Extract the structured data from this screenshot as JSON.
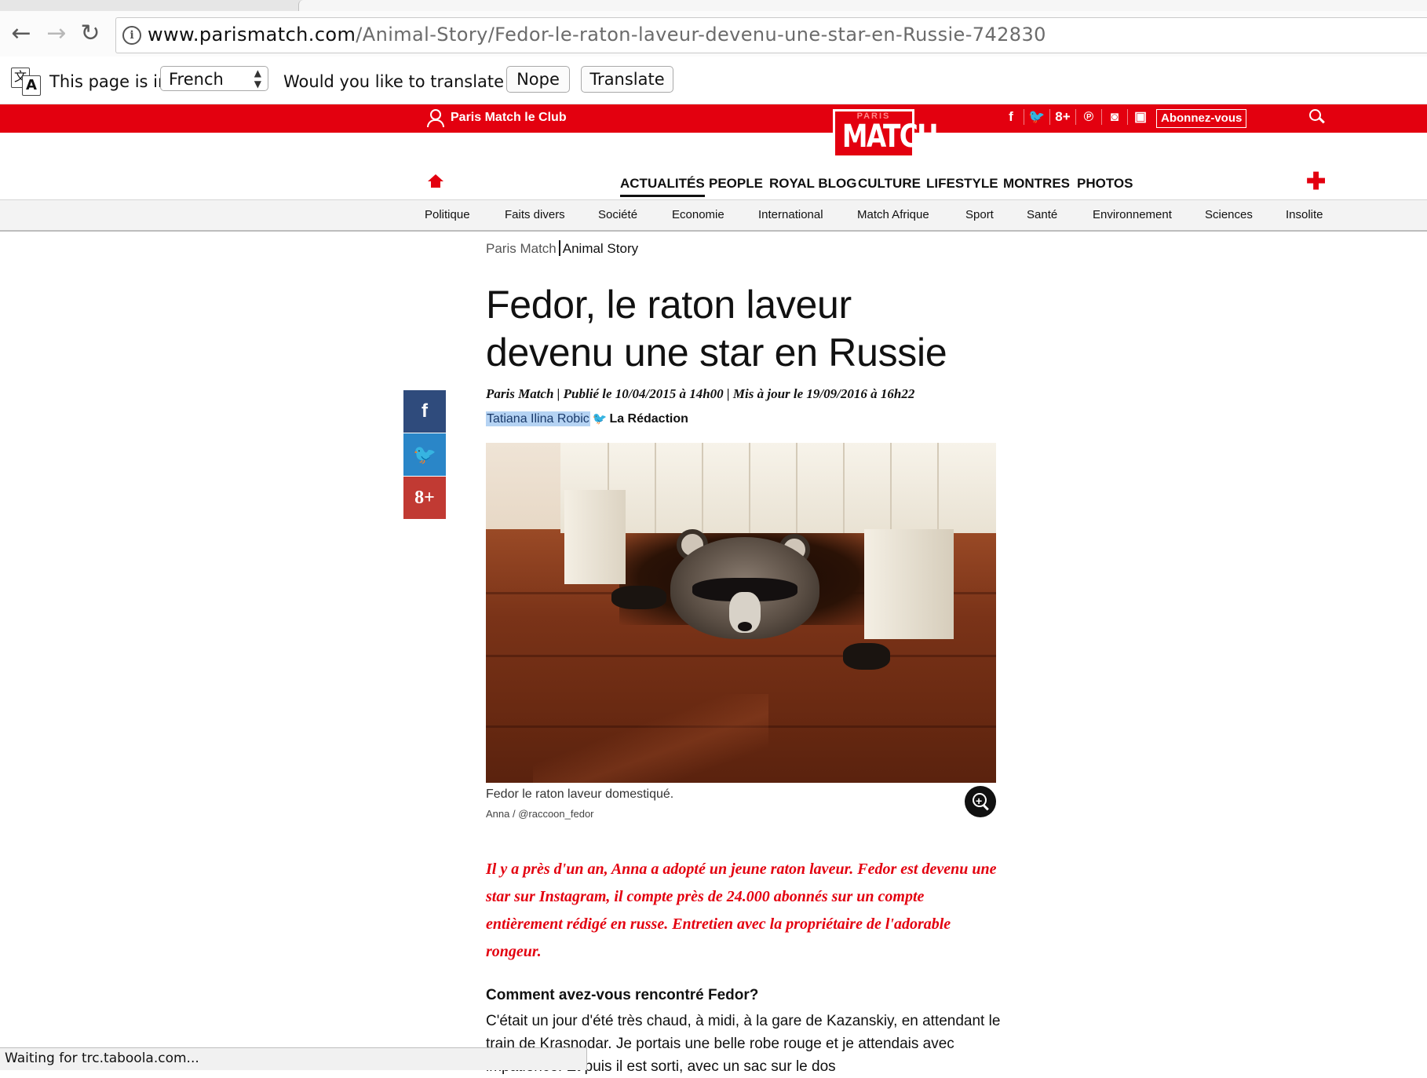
{
  "browser": {
    "url_domain": "www.parismatch.com",
    "url_path": "/Animal-Story/Fedor-le-raton-laveur-devenu-une-star-en-Russie-742830",
    "back_icon": "←",
    "forward_icon": "→",
    "reload_icon": "↻",
    "info_icon": "i",
    "status_text": "Waiting for trc.taboola.com..."
  },
  "translate_bar": {
    "icon_glyph_1": "文",
    "icon_glyph_2": "A",
    "prefix": "This page is in",
    "language": "French",
    "question": "Would you like to translate it?",
    "nope_label": "Nope",
    "translate_label": "Translate"
  },
  "site": {
    "club_label": "Paris Match le Club",
    "logo_small": "PARIS",
    "logo_big": "MATCH",
    "social": [
      "f",
      "🐦",
      "8+",
      "℗",
      "◙",
      "▣"
    ],
    "subscribe_label": "Abonnez-vous",
    "brand_color": "#e3000f",
    "main_nav": [
      "ACTUALITÉS",
      "PEOPLE",
      "ROYAL BLOG",
      "CULTURE",
      "LIFESTYLE",
      "MONTRES",
      "PHOTOS"
    ],
    "plus_glyph": "✚",
    "sub_nav": [
      "Politique",
      "Faits divers",
      "Société",
      "Economie",
      "International",
      "Match Afrique",
      "Sport",
      "Santé",
      "Environnement",
      "Sciences",
      "Insolite"
    ]
  },
  "article": {
    "breadcrumb_home": "Paris Match",
    "breadcrumb_section": "Animal Story",
    "title_line1": "Fedor, le raton laveur",
    "title_line2": "devenu une star en Russie",
    "meta": "Paris Match |  Publié le 10/04/2015 à 14h00  | Mis à jour le 19/09/2016 à 16h22",
    "author_selected": "Tatiana Ilina Robic",
    "twitter_glyph": "🐦",
    "author_team": "La Rédaction",
    "share_facebook": "f",
    "share_twitter": "🐦",
    "share_google": "8+",
    "caption": "Fedor le raton laveur domestiqué.",
    "credit": "Anna / @raccoon_fedor",
    "lead": "Il y a près d'un an, Anna a adopté un jeune raton laveur. Fedor est devenu une star sur Instagram, il compte près de 24.000 abonnés sur un compte entièrement rédigé en russe. Entretien avec la propriétaire de l'adorable rongeur.",
    "question": "Comment avez-vous rencontré Fedor?",
    "answer": "C'était un jour d'été très chaud, à midi, à la gare de Kazanskiy, en attendant le train de Krasnodar. Je portais une belle robe rouge et je attendais avec impatience. Et puis il est sorti, avec un sac sur le dos"
  }
}
